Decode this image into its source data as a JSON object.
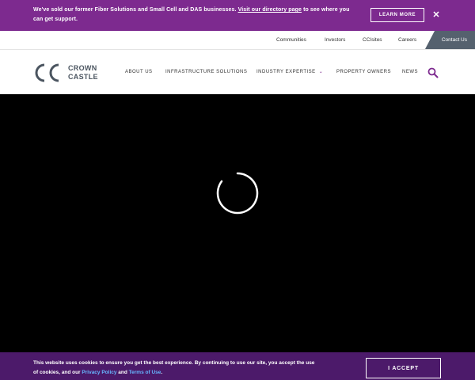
{
  "announcement": {
    "text_before": "We've sold our former Fiber Solutions and Small Cell and DAS businesses. ",
    "link": "Visit our directory page",
    "text_after": " to see where you can get support.",
    "button": "LEARN MORE",
    "close": "✕"
  },
  "utility_nav": {
    "items": [
      "Communities",
      "Investors",
      "CCIsites",
      "Careers"
    ],
    "contact": "Contact Us"
  },
  "logo": {
    "line1": "CROWN",
    "line2": "CASTLE"
  },
  "main_nav": {
    "items": [
      "ABOUT US",
      "INFRASTRUCTURE SOLUTIONS",
      "INDUSTRY EXPERTISE",
      "PROPERTY OWNERS",
      "NEWS"
    ],
    "chevron": "⌄"
  },
  "cookie": {
    "text_before": "This website uses cookies to ensure you get the best experience. By continuing to use our site, you accept the use of cookies, and our ",
    "privacy": "Privacy Policy",
    "and": " and ",
    "terms": "Terms of Use",
    "period": ".",
    "button": "I ACCEPT"
  },
  "colors": {
    "banner": "#7d2a8f",
    "cookie_bar": "#4c1a6a",
    "contact": "#55616e",
    "logo": "#4b5560"
  }
}
